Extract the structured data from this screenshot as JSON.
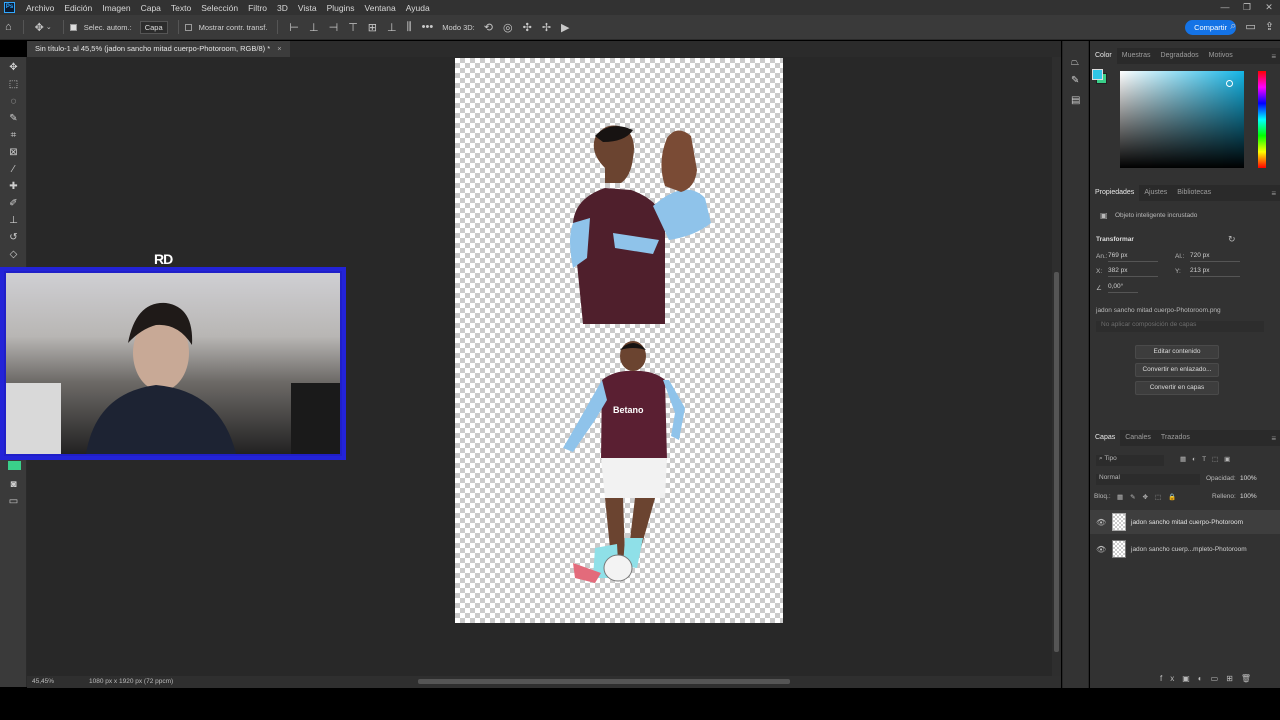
{
  "app": {
    "menus": [
      "Archivo",
      "Edición",
      "Imagen",
      "Capa",
      "Texto",
      "Selección",
      "Filtro",
      "3D",
      "Vista",
      "Plugins",
      "Ventana",
      "Ayuda"
    ]
  },
  "options_bar": {
    "auto_select_label": "Selec. autom.:",
    "auto_select_value": "Capa",
    "transform_controls_label": "Mostrar contr. transf.",
    "mode_3d_label": "Modo 3D:",
    "share_label": "Compartir"
  },
  "document": {
    "tab_title": "Sin título-1 al 45,5% (jadon sancho mitad cuerpo-Photoroom, RGB/8) *",
    "zoom": "45,45%",
    "dimensions": "1080 px x 1920 px (72 ppcm)"
  },
  "overlay": {
    "logo_text": "RD"
  },
  "color_panel": {
    "tabs": [
      "Color",
      "Muestras",
      "Degradados",
      "Motivos"
    ],
    "foreground": "#2fc6e6",
    "background": "#3ad08a"
  },
  "properties_panel": {
    "tabs": [
      "Propiedades",
      "Ajustes",
      "Bibliotecas"
    ],
    "object_type": "Objeto inteligente incrustado",
    "transform_title": "Transformar",
    "width_label": "An.:",
    "width_value": "769 px",
    "height_label": "Al.:",
    "height_value": "720 px",
    "x_label": "X:",
    "x_value": "382 px",
    "y_label": "Y:",
    "y_value": "213 px",
    "angle_value": "0,00°",
    "file_name": "jadon sancho mitad cuerpo-Photoroom.png",
    "layer_comp": "No aplicar composición de capas",
    "btn_edit": "Editar contenido",
    "btn_linked": "Convertir en enlazado...",
    "btn_layers": "Convertir en capas"
  },
  "layers_panel": {
    "tabs": [
      "Capas",
      "Canales",
      "Trazados"
    ],
    "filter_value": "Tipo",
    "blend_mode": "Normal",
    "opacity_label": "Opacidad:",
    "opacity_value": "100%",
    "lock_label": "Bloq.:",
    "fill_label": "Relleno:",
    "fill_value": "100%",
    "layers": [
      {
        "name": "jadon sancho mitad cuerpo-Photoroom",
        "selected": true
      },
      {
        "name": "jadon sancho cuerp...mpleto-Photoroom",
        "selected": false
      }
    ]
  }
}
